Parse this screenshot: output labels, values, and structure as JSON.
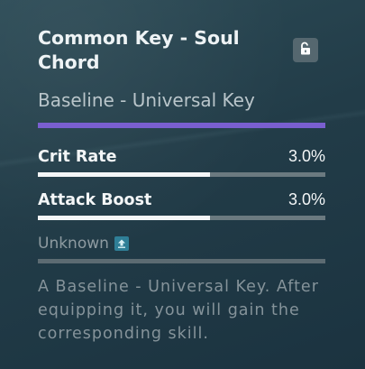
{
  "item": {
    "title": "Common Key - Soul Chord",
    "subtitle": "Baseline - Universal Key",
    "rarity_color": "#7a5fd0",
    "lock_icon": "unlocked-padlock-icon",
    "stats": [
      {
        "name": "Crit Rate",
        "value": "3.0%",
        "level": 0.6
      },
      {
        "name": "Attack Boost",
        "value": "3.0%",
        "level": 0.6
      }
    ],
    "unknown_label": "Unknown",
    "unknown_icon": "upgrade-arrow-icon",
    "description": "A Baseline - Universal Key. After equipping it, you will gain the corresponding skill."
  }
}
